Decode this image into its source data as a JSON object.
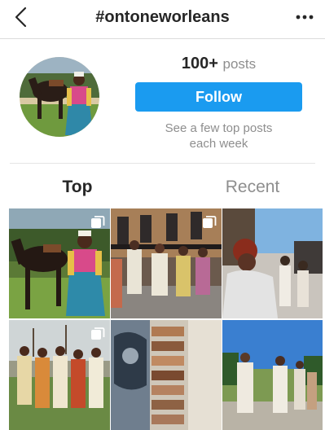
{
  "header": {
    "title": "#ontoneworleans",
    "back_icon": "chevron-left-icon",
    "more_icon": "more-dots-icon"
  },
  "profile": {
    "post_count": "100+",
    "post_unit": "posts",
    "follow_label": "Follow",
    "info_line1": "See a few top posts",
    "info_line2": "each week"
  },
  "tabs": [
    {
      "label": "Top",
      "active": true
    },
    {
      "label": "Recent",
      "active": false
    }
  ],
  "colors": {
    "accent": "#1a9bf0",
    "muted": "#8e8e8e",
    "text": "#262626"
  }
}
